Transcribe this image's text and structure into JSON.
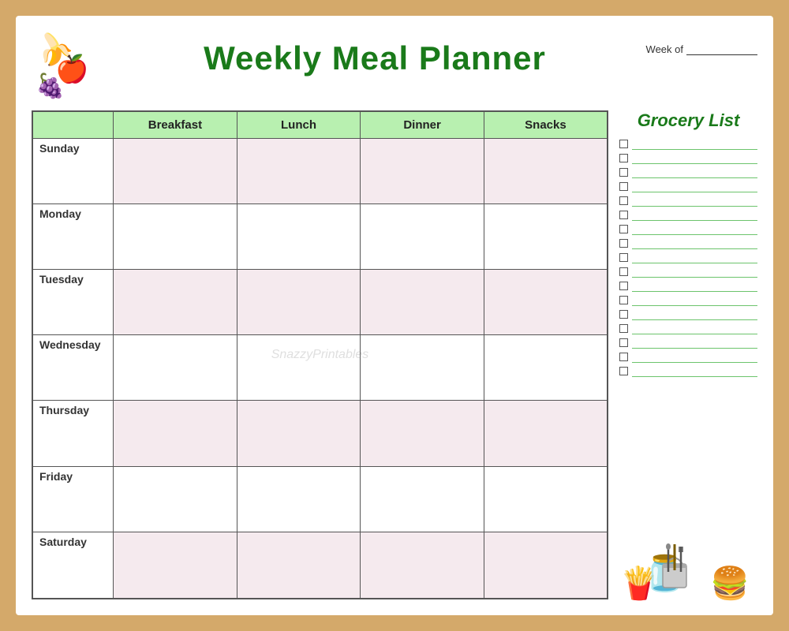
{
  "header": {
    "title": "Weekly Meal Planner",
    "week_of_label": "Week of",
    "watermark": "SnazzyPrintables"
  },
  "columns": [
    "Breakfast",
    "Lunch",
    "Dinner",
    "Snacks"
  ],
  "days": [
    "Sunday",
    "Monday",
    "Tuesday",
    "Wednesday",
    "Thursday",
    "Friday",
    "Saturday"
  ],
  "grocery": {
    "title": "Grocery List",
    "item_count": 17
  },
  "fruits": {
    "banana": "🍌",
    "apple": "🍎",
    "grapes": "🍇"
  },
  "kitchen": {
    "icons": "🍟🥪",
    "utensils": "🥄🍴"
  }
}
